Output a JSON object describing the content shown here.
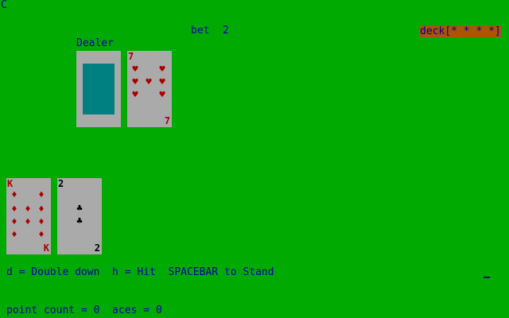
{
  "corner": "C",
  "bet": {
    "label": "bet",
    "value": "2"
  },
  "deck": {
    "text": "deck[* * * *]",
    "colors": {
      "bg": "#aa5500",
      "fg": "#0000aa"
    }
  },
  "dealer": {
    "label": "Dealer",
    "cards": [
      {
        "face": "down"
      },
      {
        "rank": "7",
        "suit": "hearts",
        "suit_glyph": "♥",
        "color": "red"
      }
    ]
  },
  "player": {
    "cards": [
      {
        "rank": "K",
        "suit": "diamonds",
        "suit_glyph": "♦",
        "color": "red"
      },
      {
        "rank": "2",
        "suit": "clubs",
        "suit_glyph": "♣",
        "color": "black"
      }
    ]
  },
  "help": "d = Double down  h = Hit  SPACEBAR to Stand",
  "status": "point count = 0  aces = 0",
  "colors": {
    "table": "#00aa00",
    "text": "#0000aa",
    "card": "#aaaaaa",
    "red_suit": "#aa0000",
    "black_suit": "#000000",
    "card_back": "#00aaaa"
  }
}
